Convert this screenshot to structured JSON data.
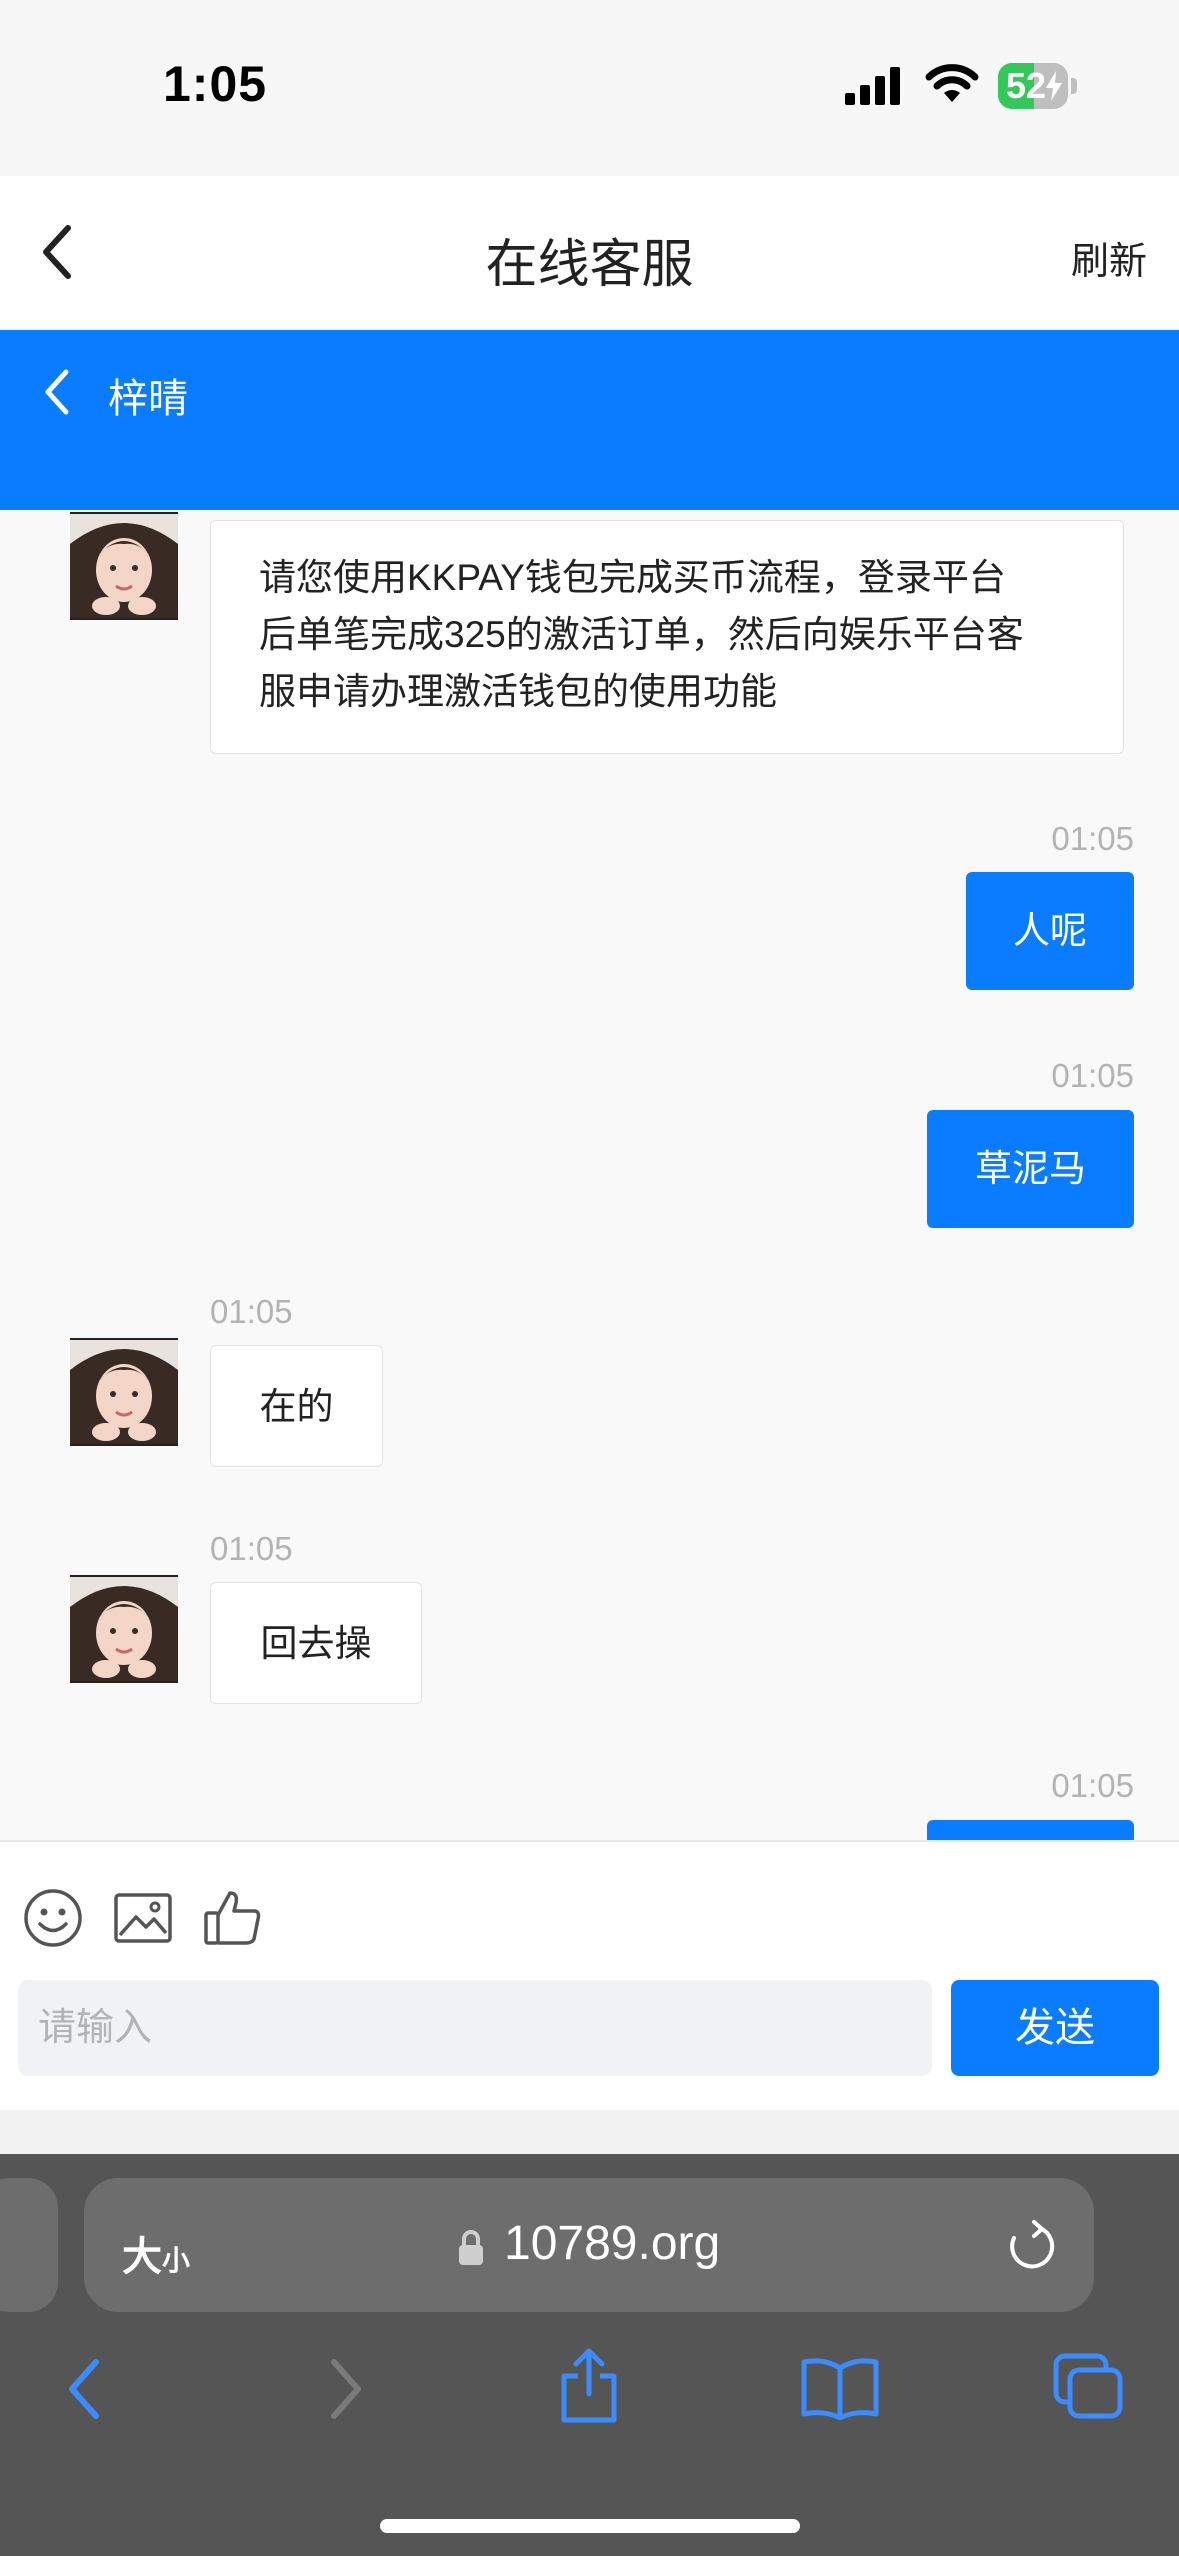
{
  "status_bar": {
    "time": "1:05",
    "battery": "52",
    "battery_level": 0.52
  },
  "nav": {
    "title": "在线客服",
    "refresh_label": "刷新"
  },
  "chat_header": {
    "agent_name": "梓晴"
  },
  "messages": [
    {
      "side": "in",
      "time": "",
      "text": "请您使用KKPAY钱包完成买币流程，登录平台后单笔完成325的激活订单，然后向娱乐平台客服申请办理激活钱包的使用功能",
      "lines": [
        "请您使用KKPAY钱包完成买币流程，登录平台",
        "后单笔完成325的激活订单，然后向娱乐平台客",
        "服申请办理激活钱包的使用功能"
      ]
    },
    {
      "side": "out",
      "time": "01:05",
      "text": "人呢"
    },
    {
      "side": "out",
      "time": "01:05",
      "text": "草泥马"
    },
    {
      "side": "in",
      "time": "01:05",
      "text": "在的"
    },
    {
      "side": "in",
      "time": "01:05",
      "text": "回去操"
    },
    {
      "side": "out",
      "time": "01:05",
      "text": ""
    }
  ],
  "input": {
    "placeholder": "请输入",
    "send_label": "发送"
  },
  "toolbar_icons": [
    "emoji-icon",
    "image-icon",
    "thumbs-up-icon"
  ],
  "browser": {
    "text_size_big": "大",
    "text_size_small": "小",
    "url": "10789.org"
  },
  "colors": {
    "accent": "#0a7cff",
    "battery": "#34c759",
    "safari_bar": "#555555"
  }
}
